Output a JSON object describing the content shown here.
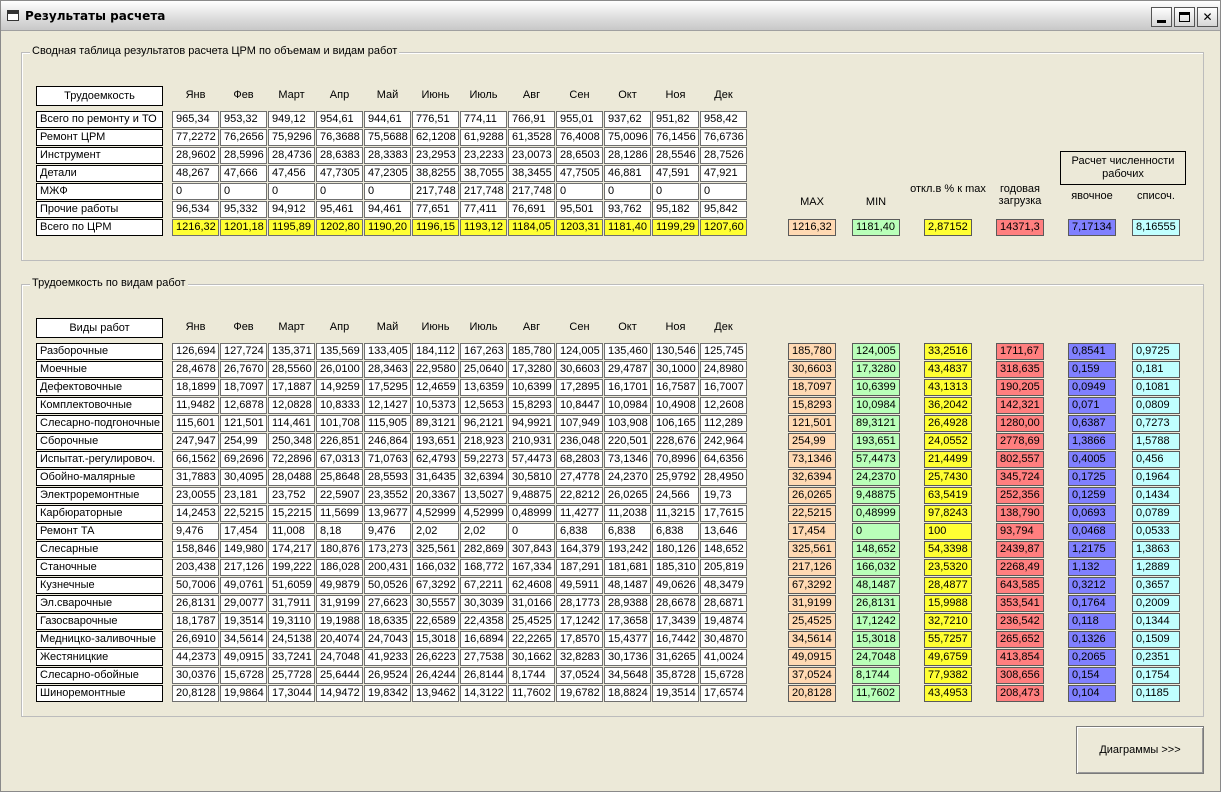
{
  "window": {
    "title": "Результаты расчета"
  },
  "top_group": {
    "legend": "Сводная таблица результатов расчета ЦРМ по объемам и видам работ",
    "row_header": "Трудоемкость",
    "calc_box": "Расчет численности рабочих",
    "stat_headers": {
      "max": "MAX",
      "min": "MIN",
      "pct": "откл.в % к max",
      "year": "годовая загрузка",
      "yav": "явочное",
      "list": "списоч."
    },
    "stats": {
      "max": "1216,32",
      "min": "1181,40",
      "pct": "2,87152",
      "year": "14371,3",
      "yav": "7,17134",
      "list": "8,16555"
    },
    "rows": [
      {
        "label": "Всего по ремонту и ТО",
        "values": [
          "965,34",
          "953,32",
          "949,12",
          "954,61",
          "944,61",
          "776,51",
          "774,11",
          "766,91",
          "955,01",
          "937,62",
          "951,82",
          "958,42"
        ]
      },
      {
        "label": "Ремонт ЦРМ",
        "values": [
          "77,2272",
          "76,2656",
          "75,9296",
          "76,3688",
          "75,5688",
          "62,1208",
          "61,9288",
          "61,3528",
          "76,4008",
          "75,0096",
          "76,1456",
          "76,6736"
        ]
      },
      {
        "label": "Инструмент",
        "values": [
          "28,9602",
          "28,5996",
          "28,4736",
          "28,6383",
          "28,3383",
          "23,2953",
          "23,2233",
          "23,0073",
          "28,6503",
          "28,1286",
          "28,5546",
          "28,7526"
        ]
      },
      {
        "label": "Детали",
        "values": [
          "48,267",
          "47,666",
          "47,456",
          "47,7305",
          "47,2305",
          "38,8255",
          "38,7055",
          "38,3455",
          "47,7505",
          "46,881",
          "47,591",
          "47,921"
        ]
      },
      {
        "label": "МЖФ",
        "values": [
          "0",
          "0",
          "0",
          "0",
          "0",
          "217,748",
          "217,748",
          "217,748",
          "0",
          "0",
          "0",
          "0"
        ]
      },
      {
        "label": "Прочие работы",
        "values": [
          "96,534",
          "95,332",
          "94,912",
          "95,461",
          "94,461",
          "77,651",
          "77,411",
          "76,691",
          "95,501",
          "93,762",
          "95,182",
          "95,842"
        ]
      },
      {
        "label": "Всего по ЦРМ",
        "values": [
          "1216,32",
          "1201,18",
          "1195,89",
          "1202,80",
          "1190,20",
          "1196,15",
          "1193,12",
          "1184,05",
          "1203,31",
          "1181,40",
          "1199,29",
          "1207,60"
        ]
      }
    ]
  },
  "months": [
    "Янв",
    "Фев",
    "Март",
    "Апр",
    "Май",
    "Июнь",
    "Июль",
    "Авг",
    "Сен",
    "Окт",
    "Ноя",
    "Дек"
  ],
  "bottom_group": {
    "legend": "Трудоемкость по видам работ",
    "row_header": "Виды работ",
    "rows": [
      {
        "label": "Разборочные",
        "values": [
          "126,694",
          "127,724",
          "135,371",
          "135,569",
          "133,405",
          "184,112",
          "167,263",
          "185,780",
          "124,005",
          "135,460",
          "130,546",
          "125,745"
        ],
        "stats": [
          "185,780",
          "124,005",
          "33,2516",
          "1711,67",
          "0,8541",
          "0,9725"
        ]
      },
      {
        "label": "Моечные",
        "values": [
          "28,4678",
          "26,7670",
          "28,5560",
          "26,0100",
          "28,3463",
          "22,9580",
          "25,0640",
          "17,3280",
          "30,6603",
          "29,4787",
          "30,1000",
          "24,8980"
        ],
        "stats": [
          "30,6603",
          "17,3280",
          "43,4837",
          "318,635",
          "0,159",
          "0,181"
        ]
      },
      {
        "label": "Дефектовочные",
        "values": [
          "18,1899",
          "18,7097",
          "17,1887",
          "14,9259",
          "17,5295",
          "12,4659",
          "13,6359",
          "10,6399",
          "17,2895",
          "16,1701",
          "16,7587",
          "16,7007"
        ],
        "stats": [
          "18,7097",
          "10,6399",
          "43,1313",
          "190,205",
          "0,0949",
          "0,1081"
        ]
      },
      {
        "label": "Комплектовочные",
        "values": [
          "11,9482",
          "12,6878",
          "12,0828",
          "10,8333",
          "12,1427",
          "10,5373",
          "12,5653",
          "15,8293",
          "10,8447",
          "10,0984",
          "10,4908",
          "12,2608"
        ],
        "stats": [
          "15,8293",
          "10,0984",
          "36,2042",
          "142,321",
          "0,071",
          "0,0809"
        ]
      },
      {
        "label": "Слесарно-подгоночные",
        "values": [
          "115,601",
          "121,501",
          "114,461",
          "101,708",
          "115,905",
          "89,3121",
          "96,2121",
          "94,9921",
          "107,949",
          "103,908",
          "106,165",
          "112,289"
        ],
        "stats": [
          "121,501",
          "89,3121",
          "26,4928",
          "1280,00",
          "0,6387",
          "0,7273"
        ]
      },
      {
        "label": "Сборочные",
        "values": [
          "247,947",
          "254,99",
          "250,348",
          "226,851",
          "246,864",
          "193,651",
          "218,923",
          "210,931",
          "236,048",
          "220,501",
          "228,676",
          "242,964"
        ],
        "stats": [
          "254,99",
          "193,651",
          "24,0552",
          "2778,69",
          "1,3866",
          "1,5788"
        ]
      },
      {
        "label": "Испытат.-регулировоч.",
        "values": [
          "66,1562",
          "69,2696",
          "72,2896",
          "67,0313",
          "71,0763",
          "62,4793",
          "59,2273",
          "57,4473",
          "68,2803",
          "73,1346",
          "70,8996",
          "64,6356"
        ],
        "stats": [
          "73,1346",
          "57,4473",
          "21,4499",
          "802,557",
          "0,4005",
          "0,456"
        ]
      },
      {
        "label": "Обойно-малярные",
        "values": [
          "31,7883",
          "30,4095",
          "28,0488",
          "25,8648",
          "28,5593",
          "31,6435",
          "32,6394",
          "30,5810",
          "27,4778",
          "24,2370",
          "25,9792",
          "28,4950"
        ],
        "stats": [
          "32,6394",
          "24,2370",
          "25,7430",
          "345,724",
          "0,1725",
          "0,1964"
        ]
      },
      {
        "label": "Электроремонтные",
        "values": [
          "23,0055",
          "23,181",
          "23,752",
          "22,5907",
          "23,3552",
          "20,3367",
          "13,5027",
          "9,48875",
          "22,8212",
          "26,0265",
          "24,566",
          "19,73"
        ],
        "stats": [
          "26,0265",
          "9,48875",
          "63,5419",
          "252,356",
          "0,1259",
          "0,1434"
        ]
      },
      {
        "label": "Карбюраторные",
        "values": [
          "14,2453",
          "22,5215",
          "15,2215",
          "11,5699",
          "13,9677",
          "4,52999",
          "4,52999",
          "0,48999",
          "11,4277",
          "11,2038",
          "11,3215",
          "17,7615"
        ],
        "stats": [
          "22,5215",
          "0,48999",
          "97,8243",
          "138,790",
          "0,0693",
          "0,0789"
        ]
      },
      {
        "label": "Ремонт ТА",
        "values": [
          "9,476",
          "17,454",
          "11,008",
          "8,18",
          "9,476",
          "2,02",
          "2,02",
          "0",
          "6,838",
          "6,838",
          "6,838",
          "13,646"
        ],
        "stats": [
          "17,454",
          "0",
          "100",
          "93,794",
          "0,0468",
          "0,0533"
        ]
      },
      {
        "label": "Слесарные",
        "values": [
          "158,846",
          "149,980",
          "174,217",
          "180,876",
          "173,273",
          "325,561",
          "282,869",
          "307,843",
          "164,379",
          "193,242",
          "180,126",
          "148,652"
        ],
        "stats": [
          "325,561",
          "148,652",
          "54,3398",
          "2439,87",
          "1,2175",
          "1,3863"
        ]
      },
      {
        "label": "Станочные",
        "values": [
          "203,438",
          "217,126",
          "199,222",
          "186,028",
          "200,431",
          "166,032",
          "168,772",
          "167,334",
          "187,291",
          "181,681",
          "185,310",
          "205,819"
        ],
        "stats": [
          "217,126",
          "166,032",
          "23,5320",
          "2268,49",
          "1,132",
          "1,2889"
        ]
      },
      {
        "label": "Кузнечные",
        "values": [
          "50,7006",
          "49,0761",
          "51,6059",
          "49,9879",
          "50,0526",
          "67,3292",
          "67,2211",
          "62,4608",
          "49,5911",
          "48,1487",
          "49,0626",
          "48,3479"
        ],
        "stats": [
          "67,3292",
          "48,1487",
          "28,4877",
          "643,585",
          "0,3212",
          "0,3657"
        ]
      },
      {
        "label": "Эл.сварочные",
        "values": [
          "26,8131",
          "29,0077",
          "31,7911",
          "31,9199",
          "27,6623",
          "30,5557",
          "30,3039",
          "31,0166",
          "28,1773",
          "28,9388",
          "28,6678",
          "28,6871"
        ],
        "stats": [
          "31,9199",
          "26,8131",
          "15,9988",
          "353,541",
          "0,1764",
          "0,2009"
        ]
      },
      {
        "label": "Газосварочные",
        "values": [
          "18,1787",
          "19,3514",
          "19,3110",
          "19,1988",
          "18,6335",
          "22,6589",
          "22,4358",
          "25,4525",
          "17,1242",
          "17,3658",
          "17,3439",
          "19,4874"
        ],
        "stats": [
          "25,4525",
          "17,1242",
          "32,7210",
          "236,542",
          "0,118",
          "0,1344"
        ]
      },
      {
        "label": "Медницко-заливочные",
        "values": [
          "26,6910",
          "34,5614",
          "24,5138",
          "20,4074",
          "24,7043",
          "15,3018",
          "16,6894",
          "22,2265",
          "17,8570",
          "15,4377",
          "16,7442",
          "30,4870"
        ],
        "stats": [
          "34,5614",
          "15,3018",
          "55,7257",
          "265,652",
          "0,1326",
          "0,1509"
        ]
      },
      {
        "label": "Жестяницкие",
        "values": [
          "44,2373",
          "49,0915",
          "33,7241",
          "24,7048",
          "41,9233",
          "26,6223",
          "27,7538",
          "30,1662",
          "32,8283",
          "30,1736",
          "31,6265",
          "41,0024"
        ],
        "stats": [
          "49,0915",
          "24,7048",
          "49,6759",
          "413,854",
          "0,2065",
          "0,2351"
        ]
      },
      {
        "label": "Слесарно-обойные",
        "values": [
          "30,0376",
          "15,6728",
          "25,7728",
          "25,6444",
          "26,9524",
          "26,4244",
          "26,8144",
          "8,1744",
          "37,0524",
          "34,5648",
          "35,8728",
          "15,6728"
        ],
        "stats": [
          "37,0524",
          "8,1744",
          "77,9382",
          "308,656",
          "0,154",
          "0,1754"
        ]
      },
      {
        "label": "Шиноремонтные",
        "values": [
          "20,8128",
          "19,9864",
          "17,3044",
          "14,9472",
          "19,8342",
          "13,9462",
          "14,3122",
          "11,7602",
          "19,6782",
          "18,8824",
          "19,3514",
          "17,6574"
        ],
        "stats": [
          "20,8128",
          "11,7602",
          "43,4953",
          "208,473",
          "0,104",
          "0,1185"
        ]
      }
    ]
  },
  "diagram_button": "Диаграммы >>>"
}
